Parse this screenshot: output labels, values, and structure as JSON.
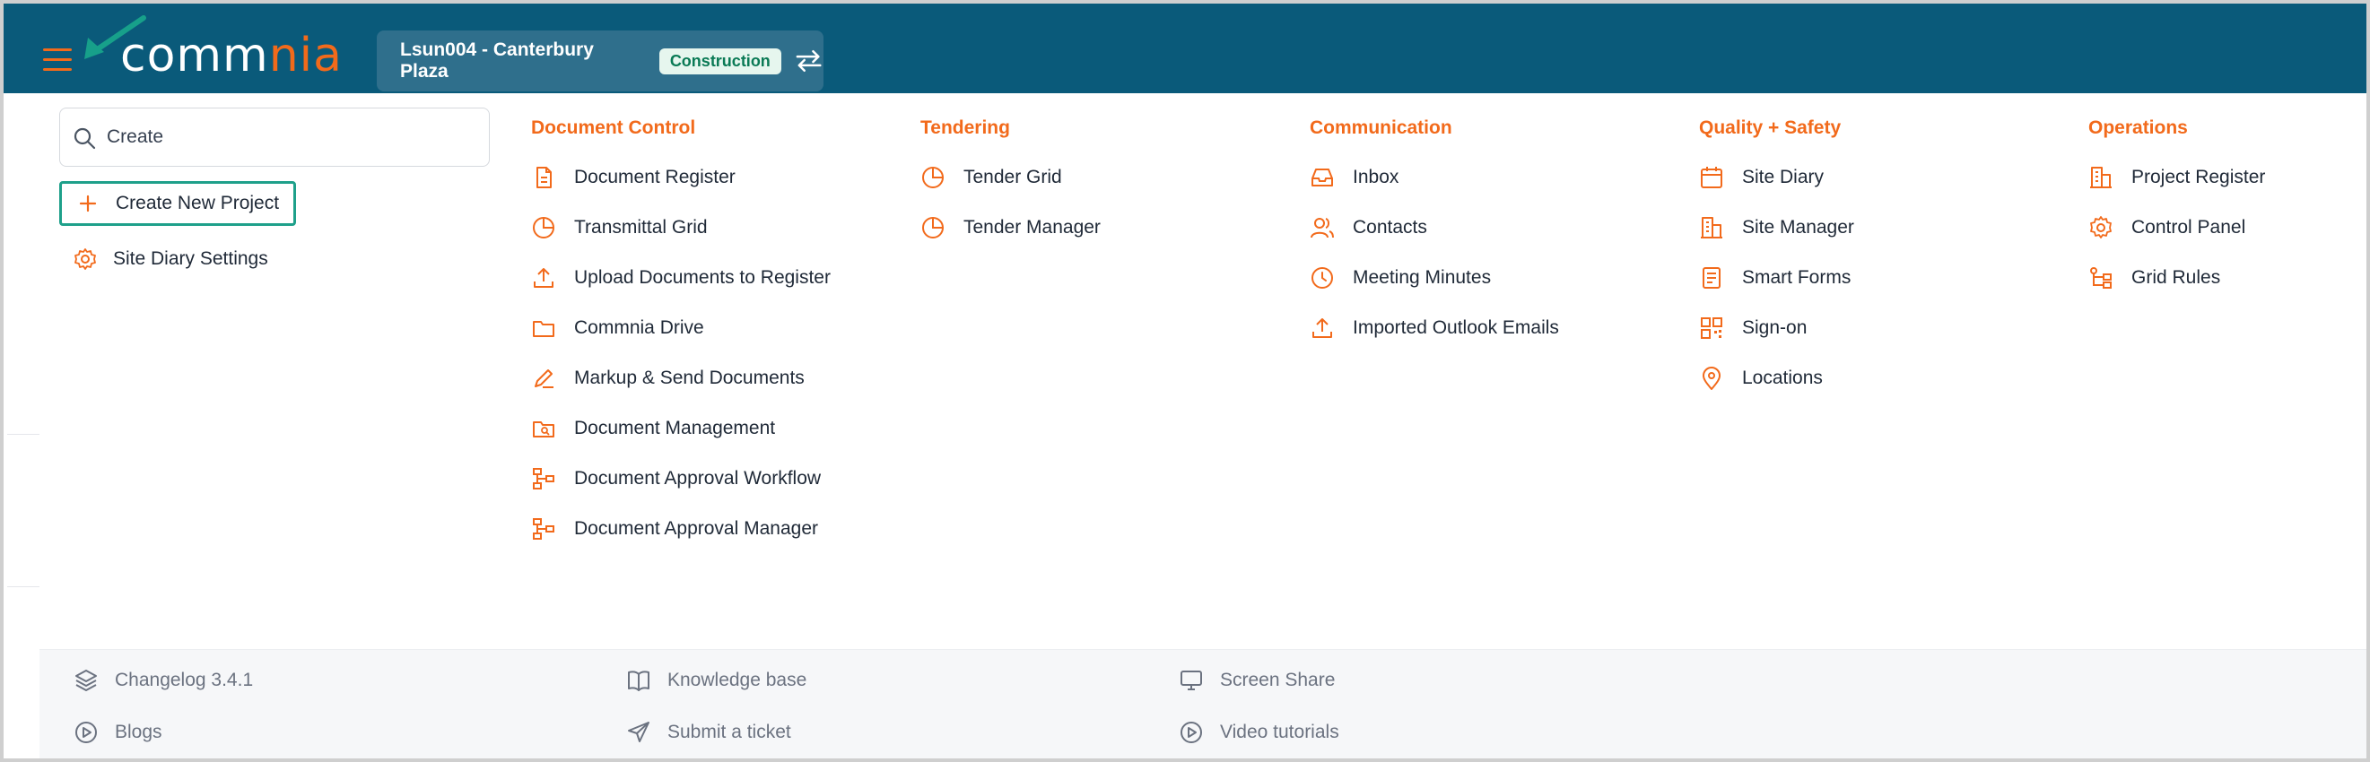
{
  "header": {
    "logo": {
      "part1": "co",
      "part2": "mm",
      "part3": "nia"
    },
    "project_name": "Lsun004 - Canterbury Plaza",
    "project_badge": "Construction",
    "colors": {
      "bar": "#0a5a7a",
      "accent": "#f26a1b",
      "badge_bg": "#e6f6ee",
      "badge_text": "#0a7a55"
    }
  },
  "search": {
    "value": "Create",
    "placeholder": "Search"
  },
  "left_items": [
    {
      "label": "Create New Project",
      "icon": "plus-icon"
    },
    {
      "label": "Site Diary Settings",
      "icon": "gear-icon"
    }
  ],
  "columns": [
    {
      "heading": "Document Control",
      "items": [
        {
          "label": "Document Register",
          "icon": "document-icon"
        },
        {
          "label": "Transmittal Grid",
          "icon": "pie-chart-icon"
        },
        {
          "label": "Upload Documents to Register",
          "icon": "upload-icon"
        },
        {
          "label": "Commnia Drive",
          "icon": "folder-icon"
        },
        {
          "label": "Markup & Send Documents",
          "icon": "pen-icon"
        },
        {
          "label": "Document Management",
          "icon": "folder-search-icon"
        },
        {
          "label": "Document Approval Workflow",
          "icon": "workflow-icon"
        },
        {
          "label": "Document Approval Manager",
          "icon": "workflow-icon"
        }
      ]
    },
    {
      "heading": "Tendering",
      "items": [
        {
          "label": "Tender Grid",
          "icon": "pie-chart-icon"
        },
        {
          "label": "Tender Manager",
          "icon": "pie-chart-icon"
        }
      ]
    },
    {
      "heading": "Communication",
      "items": [
        {
          "label": "Inbox",
          "icon": "inbox-icon"
        },
        {
          "label": "Contacts",
          "icon": "users-icon"
        },
        {
          "label": "Meeting Minutes",
          "icon": "clock-icon"
        },
        {
          "label": "Imported Outlook Emails",
          "icon": "upload-icon"
        }
      ]
    },
    {
      "heading": "Quality + Safety",
      "items": [
        {
          "label": "Site Diary",
          "icon": "calendar-icon"
        },
        {
          "label": "Site Manager",
          "icon": "building-icon"
        },
        {
          "label": "Smart Forms",
          "icon": "form-icon"
        },
        {
          "label": "Sign-on",
          "icon": "qr-code-icon"
        },
        {
          "label": "Locations",
          "icon": "map-pin-icon"
        }
      ]
    },
    {
      "heading": "Operations",
      "items": [
        {
          "label": "Project Register",
          "icon": "building-icon"
        },
        {
          "label": "Control Panel",
          "icon": "gear-icon"
        },
        {
          "label": "Grid Rules",
          "icon": "flow-icon"
        }
      ]
    }
  ],
  "footer": [
    {
      "label": "Changelog 3.4.1",
      "icon": "layers-icon"
    },
    {
      "label": "Knowledge base",
      "icon": "book-icon"
    },
    {
      "label": "Screen Share",
      "icon": "screen-share-icon"
    },
    {
      "label": "Blogs",
      "icon": "play-circle-icon"
    },
    {
      "label": "Submit a ticket",
      "icon": "send-icon"
    },
    {
      "label": "Video tutorials",
      "icon": "play-circle-icon"
    }
  ]
}
